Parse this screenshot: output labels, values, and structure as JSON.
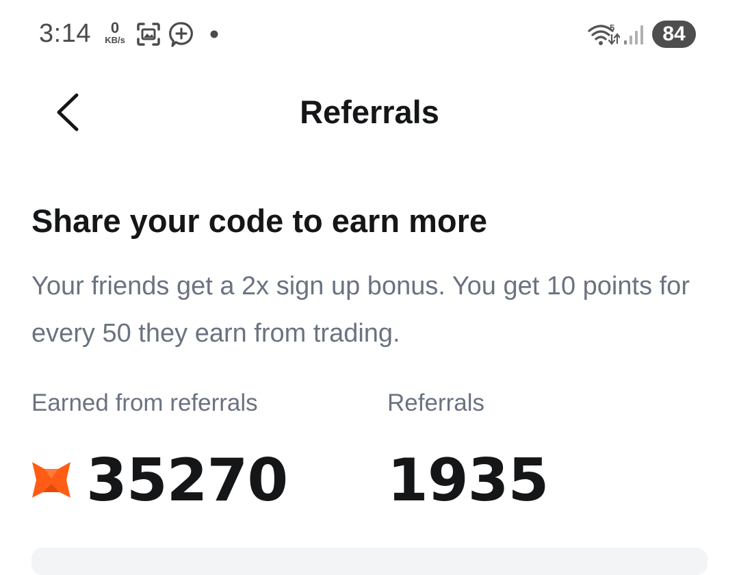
{
  "status_bar": {
    "time": "3:14",
    "net_speed_value": "0",
    "net_speed_unit": "KB/s",
    "battery": "84",
    "icons": [
      "screenshot-icon",
      "add-circle-icon",
      "dot-icon",
      "wifi-icon",
      "signal-icon",
      "battery-icon"
    ]
  },
  "header": {
    "title": "Referrals",
    "back_icon": "chevron-left-icon"
  },
  "content": {
    "headline": "Share your code to earn more",
    "description": "Your friends get a 2x sign up bonus. You get 10 points for every 50 they earn from trading.",
    "stats": {
      "earned_label": "Earned from referrals",
      "earned_value": "35270",
      "earned_icon": "fox-icon",
      "referrals_label": "Referrals",
      "referrals_value": "1935"
    }
  },
  "colors": {
    "text_primary": "#141618",
    "text_secondary": "#6b7280",
    "accent_fox": "#ff5c16",
    "card_bg": "#f2f4f6"
  }
}
